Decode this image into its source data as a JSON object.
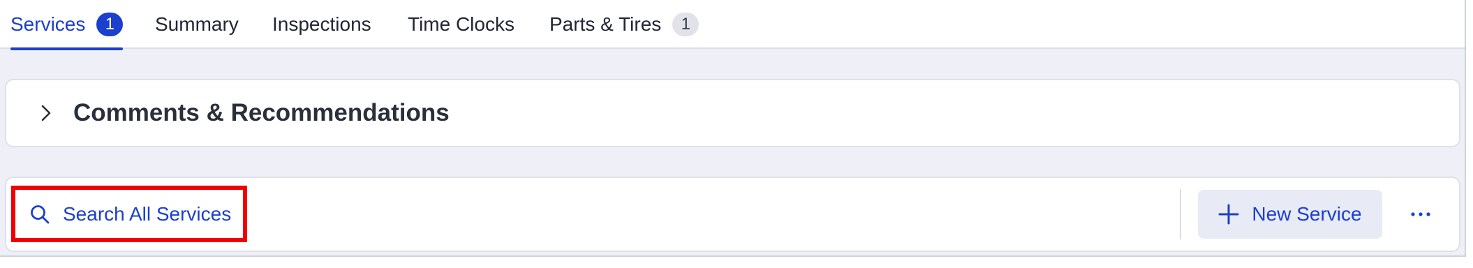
{
  "tabs": [
    {
      "label": "Services",
      "badge": "1",
      "active": true
    },
    {
      "label": "Summary",
      "badge": null,
      "active": false
    },
    {
      "label": "Inspections",
      "badge": null,
      "active": false
    },
    {
      "label": "Time Clocks",
      "badge": null,
      "active": false
    },
    {
      "label": "Parts & Tires",
      "badge": "1",
      "active": false
    }
  ],
  "comments": {
    "title": "Comments & Recommendations",
    "icon": "chevron-right-icon"
  },
  "services_toolbar": {
    "search_label": "Search All Services",
    "search_icon": "search-icon",
    "new_service_label": "New Service",
    "new_service_icon": "plus-icon",
    "more_icon": "more-horizontal-icon"
  },
  "colors": {
    "accent": "#1b3fcf",
    "highlight_border": "#f00000",
    "background": "#efeff8"
  }
}
